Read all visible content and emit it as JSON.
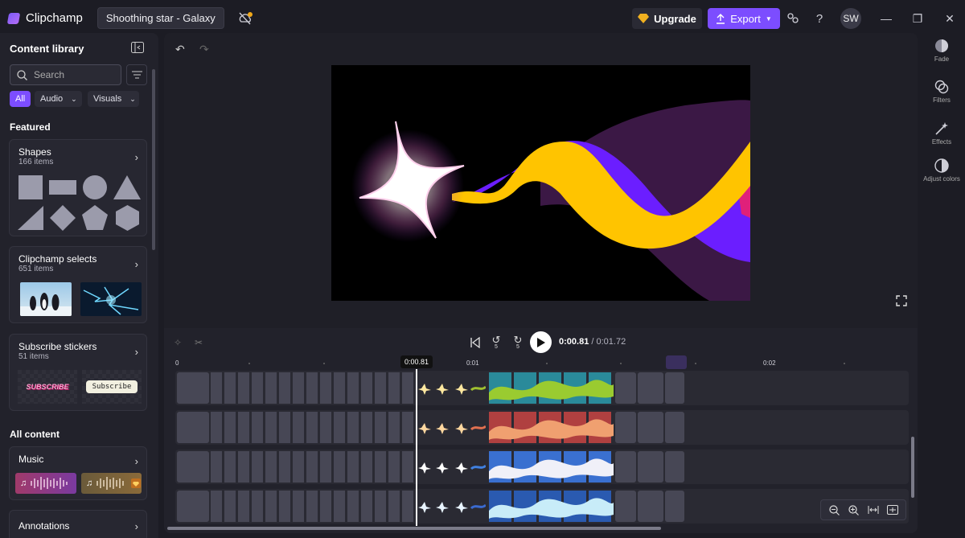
{
  "app": {
    "name": "Clipchamp",
    "project_title": "Shoothing star - Galaxy"
  },
  "header": {
    "upgrade_label": "Upgrade",
    "export_label": "Export",
    "avatar_initials": "SW",
    "help_label": "?"
  },
  "colors": {
    "accent": "#7c4dff",
    "yellow": "#ffc400",
    "purple": "#6b1eff",
    "dark_purple": "#3b1845",
    "pink": "#e0207a"
  },
  "sidebar": {
    "title": "Content library",
    "search_placeholder": "Search",
    "chips": [
      {
        "label": "All"
      },
      {
        "label": "Audio"
      },
      {
        "label": "Visuals"
      }
    ],
    "featured_title": "Featured",
    "shapes": {
      "title": "Shapes",
      "count": "166 items"
    },
    "selects": {
      "title": "Clipchamp selects",
      "count": "651 items"
    },
    "stickers": {
      "title": "Subscribe stickers",
      "count": "51 items",
      "sticker1": "SUBSCRIBE",
      "sticker2": "Subscribe"
    },
    "all_content_title": "All content",
    "music": {
      "title": "Music"
    },
    "annotations": {
      "title": "Annotations"
    }
  },
  "player": {
    "current_time": "0:00.81",
    "total_time": "/ 0:01.72",
    "skip_back": "5",
    "skip_fwd": "5"
  },
  "timeline": {
    "ruler": [
      "0",
      "0:01",
      "0:02"
    ],
    "playhead_label": "0:00.81"
  },
  "right_rail": [
    {
      "label": "Fade",
      "icon": "fade-icon"
    },
    {
      "label": "Filters",
      "icon": "filters-icon"
    },
    {
      "label": "Effects",
      "icon": "effects-icon"
    },
    {
      "label": "Adjust colors",
      "icon": "adjust-colors-icon"
    }
  ]
}
